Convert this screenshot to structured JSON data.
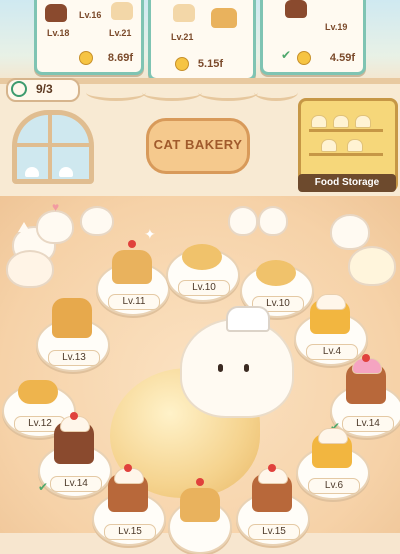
{
  "orders": [
    {
      "levels": [
        "Lv.16",
        "Lv.18",
        "Lv.21"
      ],
      "price": "8.69f"
    },
    {
      "levels": [
        "Lv.21"
      ],
      "price": "5.15f"
    },
    {
      "levels": [
        "Lv.19"
      ],
      "price": "4.59f"
    }
  ],
  "customers": {
    "counter": "9/3"
  },
  "storage": {
    "label": "Food Storage"
  },
  "sign": {
    "text": "CAT BAKERY"
  },
  "plates": [
    {
      "level": "Lv.11",
      "food": "fruit-tart",
      "color": "#e9b25d"
    },
    {
      "level": "Lv.10",
      "food": "paw-pie",
      "color": "#f0c26b"
    },
    {
      "level": "Lv.10",
      "food": "paw-pie",
      "color": "#f0c26b"
    },
    {
      "level": "Lv.13",
      "food": "muffin",
      "color": "#e7a94c"
    },
    {
      "level": "Lv.4",
      "food": "pudding",
      "color": "#f2b640"
    },
    {
      "level": "Lv.12",
      "food": "croissant",
      "color": "#eeb44d"
    },
    {
      "level": "Lv.14",
      "food": "cupcake",
      "color": "#b8683a"
    },
    {
      "level": "Lv.14",
      "food": "cupcake",
      "color": "#8a4a2e"
    },
    {
      "level": "Lv.6",
      "food": "pudding",
      "color": "#f2b640"
    },
    {
      "level": "Lv.15",
      "food": "cat-cupcake",
      "color": "#b8683a"
    },
    {
      "level": "Lv.15",
      "food": "cat-cupcake",
      "color": "#b8683a"
    }
  ]
}
